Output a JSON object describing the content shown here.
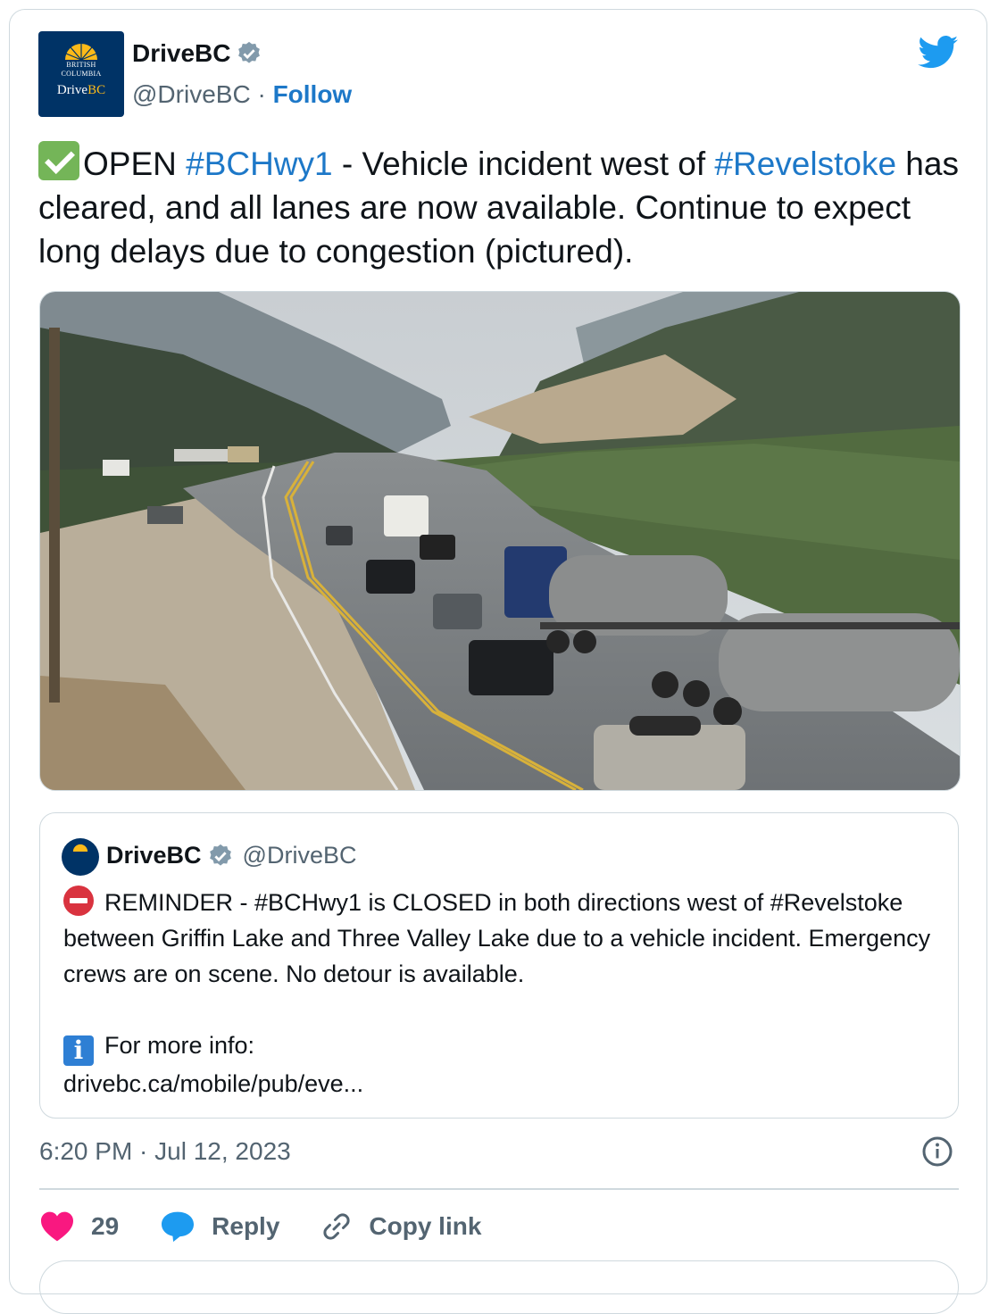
{
  "account": {
    "name": "DriveBC",
    "handle": "@DriveBC",
    "separator": " · ",
    "follow_label": "Follow",
    "avatar_line1": "BRITISH",
    "avatar_line2": "COLUMBIA",
    "avatar_brand_a": "Drive",
    "avatar_brand_b": "BC"
  },
  "tweet": {
    "part1": "OPEN ",
    "tag1": "#BCHwy1",
    "part2": " - Vehicle incident west of ",
    "tag2": "#Revelstoke",
    "part3": " has cleared, and all lanes are now available. Continue to expect long delays due to congestion (pictured).",
    "timestamp": "6:20 PM · Jul 12, 2023"
  },
  "quoted": {
    "name": "DriveBC",
    "handle": "@DriveBC",
    "line1": "REMINDER - #BCHwy1 is CLOSED in both directions west of #Revelstoke between Griffin Lake and Three Valley Lake due to a vehicle incident. Emergency crews are on scene. No detour is available.",
    "info_label": "For more info:",
    "link": "drivebc.ca/mobile/pub/eve..."
  },
  "actions": {
    "likes": "29",
    "reply_label": "Reply",
    "copy_label": "Copy link"
  },
  "colors": {
    "link_blue": "#1d78c8",
    "twitter_blue": "#1d9bf0",
    "like_red": "#f91880",
    "border": "#cfd9de"
  },
  "icons": [
    "verified-badge-icon",
    "twitter-bird-icon",
    "check-mark-icon",
    "no-entry-icon",
    "info-icon",
    "heart-icon",
    "reply-bubble-icon",
    "link-icon"
  ]
}
